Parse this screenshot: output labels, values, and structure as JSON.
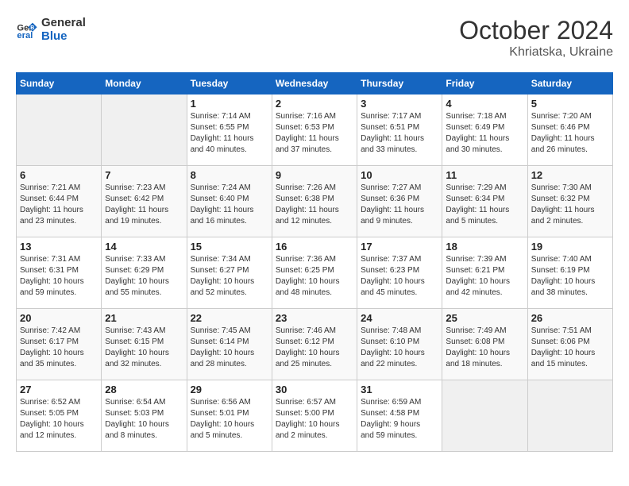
{
  "logo": {
    "line1": "General",
    "line2": "Blue"
  },
  "title": "October 2024",
  "subtitle": "Khriatska, Ukraine",
  "days_of_week": [
    "Sunday",
    "Monday",
    "Tuesday",
    "Wednesday",
    "Thursday",
    "Friday",
    "Saturday"
  ],
  "weeks": [
    [
      {
        "num": "",
        "info": ""
      },
      {
        "num": "",
        "info": ""
      },
      {
        "num": "1",
        "info": "Sunrise: 7:14 AM\nSunset: 6:55 PM\nDaylight: 11 hours\nand 40 minutes."
      },
      {
        "num": "2",
        "info": "Sunrise: 7:16 AM\nSunset: 6:53 PM\nDaylight: 11 hours\nand 37 minutes."
      },
      {
        "num": "3",
        "info": "Sunrise: 7:17 AM\nSunset: 6:51 PM\nDaylight: 11 hours\nand 33 minutes."
      },
      {
        "num": "4",
        "info": "Sunrise: 7:18 AM\nSunset: 6:49 PM\nDaylight: 11 hours\nand 30 minutes."
      },
      {
        "num": "5",
        "info": "Sunrise: 7:20 AM\nSunset: 6:46 PM\nDaylight: 11 hours\nand 26 minutes."
      }
    ],
    [
      {
        "num": "6",
        "info": "Sunrise: 7:21 AM\nSunset: 6:44 PM\nDaylight: 11 hours\nand 23 minutes."
      },
      {
        "num": "7",
        "info": "Sunrise: 7:23 AM\nSunset: 6:42 PM\nDaylight: 11 hours\nand 19 minutes."
      },
      {
        "num": "8",
        "info": "Sunrise: 7:24 AM\nSunset: 6:40 PM\nDaylight: 11 hours\nand 16 minutes."
      },
      {
        "num": "9",
        "info": "Sunrise: 7:26 AM\nSunset: 6:38 PM\nDaylight: 11 hours\nand 12 minutes."
      },
      {
        "num": "10",
        "info": "Sunrise: 7:27 AM\nSunset: 6:36 PM\nDaylight: 11 hours\nand 9 minutes."
      },
      {
        "num": "11",
        "info": "Sunrise: 7:29 AM\nSunset: 6:34 PM\nDaylight: 11 hours\nand 5 minutes."
      },
      {
        "num": "12",
        "info": "Sunrise: 7:30 AM\nSunset: 6:32 PM\nDaylight: 11 hours\nand 2 minutes."
      }
    ],
    [
      {
        "num": "13",
        "info": "Sunrise: 7:31 AM\nSunset: 6:31 PM\nDaylight: 10 hours\nand 59 minutes."
      },
      {
        "num": "14",
        "info": "Sunrise: 7:33 AM\nSunset: 6:29 PM\nDaylight: 10 hours\nand 55 minutes."
      },
      {
        "num": "15",
        "info": "Sunrise: 7:34 AM\nSunset: 6:27 PM\nDaylight: 10 hours\nand 52 minutes."
      },
      {
        "num": "16",
        "info": "Sunrise: 7:36 AM\nSunset: 6:25 PM\nDaylight: 10 hours\nand 48 minutes."
      },
      {
        "num": "17",
        "info": "Sunrise: 7:37 AM\nSunset: 6:23 PM\nDaylight: 10 hours\nand 45 minutes."
      },
      {
        "num": "18",
        "info": "Sunrise: 7:39 AM\nSunset: 6:21 PM\nDaylight: 10 hours\nand 42 minutes."
      },
      {
        "num": "19",
        "info": "Sunrise: 7:40 AM\nSunset: 6:19 PM\nDaylight: 10 hours\nand 38 minutes."
      }
    ],
    [
      {
        "num": "20",
        "info": "Sunrise: 7:42 AM\nSunset: 6:17 PM\nDaylight: 10 hours\nand 35 minutes."
      },
      {
        "num": "21",
        "info": "Sunrise: 7:43 AM\nSunset: 6:15 PM\nDaylight: 10 hours\nand 32 minutes."
      },
      {
        "num": "22",
        "info": "Sunrise: 7:45 AM\nSunset: 6:14 PM\nDaylight: 10 hours\nand 28 minutes."
      },
      {
        "num": "23",
        "info": "Sunrise: 7:46 AM\nSunset: 6:12 PM\nDaylight: 10 hours\nand 25 minutes."
      },
      {
        "num": "24",
        "info": "Sunrise: 7:48 AM\nSunset: 6:10 PM\nDaylight: 10 hours\nand 22 minutes."
      },
      {
        "num": "25",
        "info": "Sunrise: 7:49 AM\nSunset: 6:08 PM\nDaylight: 10 hours\nand 18 minutes."
      },
      {
        "num": "26",
        "info": "Sunrise: 7:51 AM\nSunset: 6:06 PM\nDaylight: 10 hours\nand 15 minutes."
      }
    ],
    [
      {
        "num": "27",
        "info": "Sunrise: 6:52 AM\nSunset: 5:05 PM\nDaylight: 10 hours\nand 12 minutes."
      },
      {
        "num": "28",
        "info": "Sunrise: 6:54 AM\nSunset: 5:03 PM\nDaylight: 10 hours\nand 8 minutes."
      },
      {
        "num": "29",
        "info": "Sunrise: 6:56 AM\nSunset: 5:01 PM\nDaylight: 10 hours\nand 5 minutes."
      },
      {
        "num": "30",
        "info": "Sunrise: 6:57 AM\nSunset: 5:00 PM\nDaylight: 10 hours\nand 2 minutes."
      },
      {
        "num": "31",
        "info": "Sunrise: 6:59 AM\nSunset: 4:58 PM\nDaylight: 9 hours\nand 59 minutes."
      },
      {
        "num": "",
        "info": ""
      },
      {
        "num": "",
        "info": ""
      }
    ]
  ]
}
